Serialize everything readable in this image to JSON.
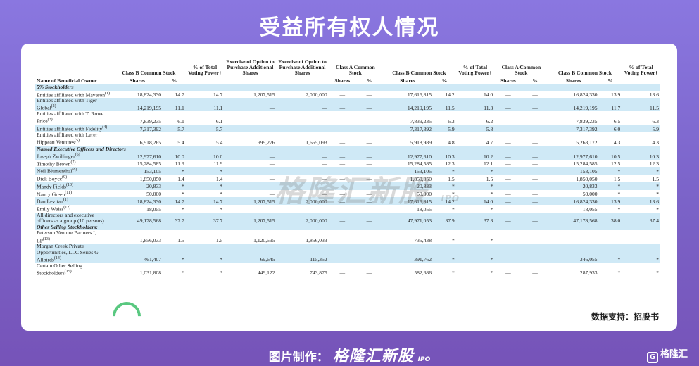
{
  "page_title": "受益所有权人情况",
  "source": "数据支持：招股书",
  "watermark": {
    "text": "格隆汇新股",
    "suffix": "IPO"
  },
  "footer": {
    "label": "图片制作：",
    "brand": "格隆汇新股",
    "suffix": "IPO",
    "logo_mark": "G",
    "logo_text": "格隆汇"
  },
  "table": {
    "header": {
      "name_col": "Name of Beneficial Owner",
      "class_b": "Class B Common Stock",
      "pct_voting": "% of Total Voting Power†",
      "exercise_option": "Exercise of Option to Purchase Additional Shares",
      "class_a": "Class A Common Stock",
      "shares": "Shares",
      "pct": "%"
    },
    "rows": [
      {
        "type": "section",
        "name": "5% Stockholders"
      },
      {
        "type": "data",
        "name": "Entities affiliated with Maveron",
        "sup": "(1)",
        "v": [
          "18,824,330",
          "14.7",
          "14.7",
          "1,207,515",
          "2,000,000",
          "—",
          "—",
          "17,616,815",
          "14.2",
          "14.0",
          "—",
          "—",
          "16,824,330",
          "13.9",
          "13.6"
        ]
      },
      {
        "type": "data",
        "name": "Entities affiliated with Tiger Global",
        "sup": "(2)",
        "v": [
          "14,219,195",
          "11.1",
          "11.1",
          "—",
          "—",
          "—",
          "—",
          "14,219,195",
          "11.5",
          "11.3",
          "—",
          "—",
          "14,219,195",
          "11.7",
          "11.5"
        ]
      },
      {
        "type": "data",
        "name": "Entities affiliated with T. Rowe Price",
        "sup": "(3)",
        "v": [
          "7,839,235",
          "6.1",
          "6.1",
          "—",
          "—",
          "—",
          "—",
          "7,839,235",
          "6.3",
          "6.2",
          "—",
          "—",
          "7,839,235",
          "6.5",
          "6.3"
        ]
      },
      {
        "type": "data",
        "name": "Entities affiliated with Fidelity",
        "sup": "(4)",
        "v": [
          "7,317,392",
          "5.7",
          "5.7",
          "—",
          "—",
          "—",
          "—",
          "7,317,392",
          "5.9",
          "5.8",
          "—",
          "—",
          "7,317,392",
          "6.0",
          "5.9"
        ]
      },
      {
        "type": "data",
        "name": "Entities affiliated with Lerer Hippeau Ventures",
        "sup": "(5)",
        "v": [
          "6,918,265",
          "5.4",
          "5.4",
          "999,276",
          "1,655,093",
          "—",
          "—",
          "5,918,989",
          "4.8",
          "4.7",
          "—",
          "—",
          "5,263,172",
          "4.3",
          "4.3"
        ]
      },
      {
        "type": "section",
        "name": "Named Executive Officers and Directors"
      },
      {
        "type": "data",
        "name": "Joseph Zwillinger",
        "sup": "(6)",
        "v": [
          "12,977,610",
          "10.0",
          "10.0",
          "—",
          "—",
          "—",
          "—",
          "12,977,610",
          "10.3",
          "10.2",
          "—",
          "—",
          "12,977,610",
          "10.5",
          "10.3"
        ]
      },
      {
        "type": "data",
        "name": "Timothy Brown",
        "sup": "(7)",
        "v": [
          "15,284,585",
          "11.9",
          "11.9",
          "—",
          "—",
          "—",
          "—",
          "15,284,585",
          "12.3",
          "12.1",
          "—",
          "—",
          "15,284,585",
          "12.5",
          "12.3"
        ]
      },
      {
        "type": "data",
        "name": "Neil Blumenthal",
        "sup": "(8)",
        "v": [
          "153,105",
          "*",
          "*",
          "—",
          "—",
          "—",
          "—",
          "153,105",
          "*",
          "*",
          "—",
          "—",
          "153,105",
          "*",
          "*"
        ]
      },
      {
        "type": "data",
        "name": "Dick Boyce",
        "sup": "(9)",
        "v": [
          "1,850,050",
          "1.4",
          "1.4",
          "—",
          "—",
          "—",
          "—",
          "1,850,050",
          "1.5",
          "1.5",
          "—",
          "—",
          "1,850,050",
          "1.5",
          "1.5"
        ]
      },
      {
        "type": "data",
        "name": "Mandy Fields",
        "sup": "(10)",
        "v": [
          "20,833",
          "*",
          "*",
          "—",
          "—",
          "—",
          "—",
          "20,833",
          "*",
          "*",
          "—",
          "—",
          "20,833",
          "*",
          "*"
        ]
      },
      {
        "type": "data",
        "name": "Nancy Green",
        "sup": "(11)",
        "v": [
          "50,000",
          "*",
          "*",
          "—",
          "—",
          "—",
          "—",
          "50,000",
          "*",
          "*",
          "—",
          "—",
          "50,000",
          "*",
          "*"
        ]
      },
      {
        "type": "data",
        "name": "Dan Levitan",
        "sup": "(1)",
        "v": [
          "18,824,330",
          "14.7",
          "14.7",
          "1,207,515",
          "2,000,000",
          "—",
          "—",
          "17,616,815",
          "14.2",
          "14.0",
          "—",
          "—",
          "16,824,330",
          "13.9",
          "13.6"
        ]
      },
      {
        "type": "data",
        "name": "Emily Weiss",
        "sup": "(12)",
        "v": [
          "18,055",
          "*",
          "*",
          "—",
          "—",
          "—",
          "—",
          "18,055",
          "*",
          "*",
          "—",
          "—",
          "18,055",
          "*",
          "*"
        ]
      },
      {
        "type": "data",
        "name": "All directors and executive officers as a group (10 persons)",
        "sup": "",
        "v": [
          "49,178,568",
          "37.7",
          "37.7",
          "1,207,515",
          "2,000,000",
          "—",
          "—",
          "47,971,053",
          "37.9",
          "37.3",
          "—",
          "—",
          "47,178,568",
          "38.0",
          "37.4"
        ]
      },
      {
        "type": "section",
        "name": "Other Selling Stockholders:"
      },
      {
        "type": "data",
        "name": "Peterson Venture Partners I, LP",
        "sup": "(13)",
        "v": [
          "1,856,033",
          "1.5",
          "1.5",
          "1,120,595",
          "1,856,033",
          "—",
          "—",
          "735,438",
          "*",
          "*",
          "—",
          "—",
          "—",
          "—",
          "—"
        ]
      },
      {
        "type": "data",
        "name": "Morgan Creek Private Opportunities, LLC Series G Allbirds",
        "sup": "(14)",
        "v": [
          "461,407",
          "*",
          "*",
          "69,645",
          "115,352",
          "—",
          "—",
          "391,762",
          "*",
          "*",
          "—",
          "—",
          "346,055",
          "*",
          "*"
        ]
      },
      {
        "type": "data",
        "name": "Certain Other Selling Stockholders",
        "sup": "(15)",
        "v": [
          "1,031,808",
          "*",
          "*",
          "449,122",
          "743,875",
          "—",
          "—",
          "582,686",
          "*",
          "*",
          "—",
          "—",
          "287,933",
          "*",
          "*"
        ]
      }
    ]
  }
}
